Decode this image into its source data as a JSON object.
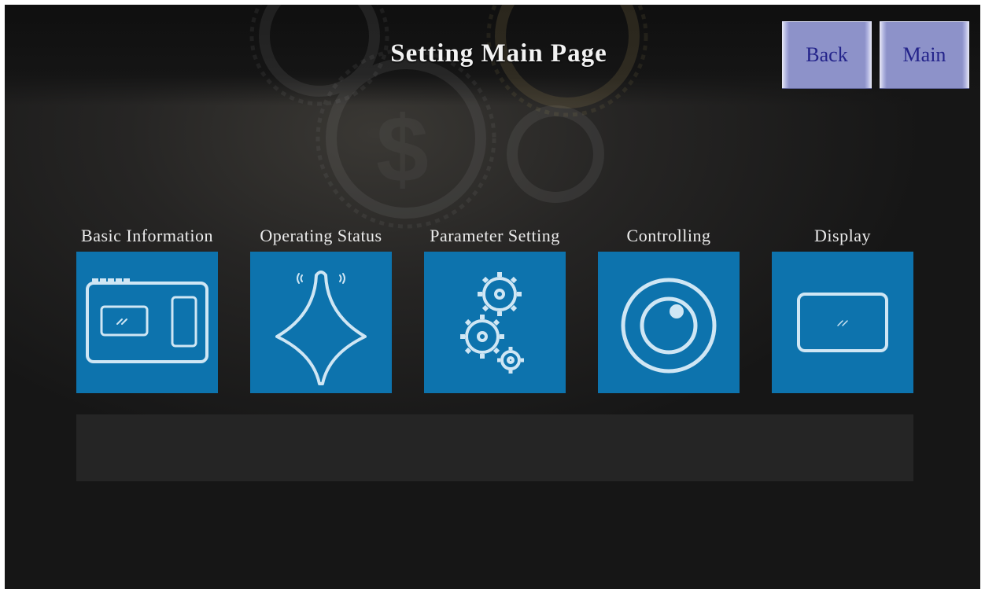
{
  "header": {
    "title": "Setting Main Page",
    "back_label": "Back",
    "main_label": "Main"
  },
  "tiles": [
    {
      "label": "Basic Information",
      "icon": "monitor-panel-icon"
    },
    {
      "label": "Operating Status",
      "icon": "spinning-top-icon"
    },
    {
      "label": "Parameter Setting",
      "icon": "gears-icon"
    },
    {
      "label": "Controlling",
      "icon": "camera-lens-icon"
    },
    {
      "label": "Display",
      "icon": "screen-icon"
    }
  ],
  "colors": {
    "tile_blue": "#0d73ad",
    "button_purple": "#8d92c9",
    "button_text": "#23238a"
  }
}
